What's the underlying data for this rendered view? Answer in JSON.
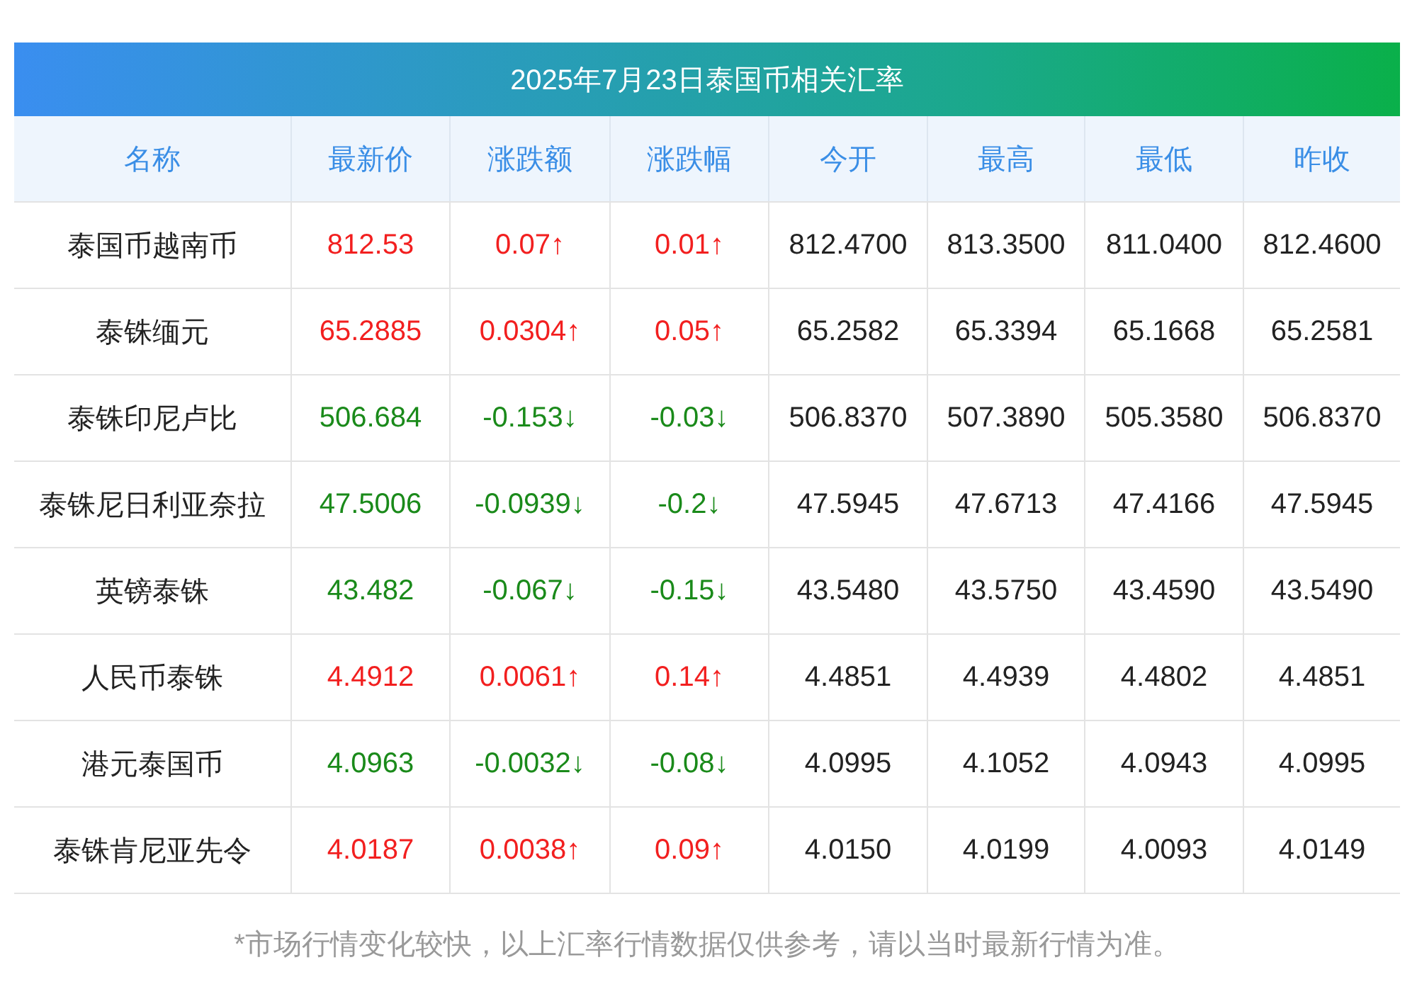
{
  "title": "2025年7月23日泰国币相关汇率",
  "columns": [
    "名称",
    "最新价",
    "涨跌额",
    "涨跌幅",
    "今开",
    "最高",
    "最低",
    "昨收"
  ],
  "rows": [
    {
      "rising": true,
      "cells": [
        "泰国币越南币",
        "812.53",
        "0.07↑",
        "0.01↑",
        "812.4700",
        "813.3500",
        "811.0400",
        "812.4600"
      ]
    },
    {
      "rising": true,
      "cells": [
        "泰铢缅元",
        "65.2885",
        "0.0304↑",
        "0.05↑",
        "65.2582",
        "65.3394",
        "65.1668",
        "65.2581"
      ]
    },
    {
      "rising": false,
      "cells": [
        "泰铢印尼卢比",
        "506.684",
        "-0.153↓",
        "-0.03↓",
        "506.8370",
        "507.3890",
        "505.3580",
        "506.8370"
      ]
    },
    {
      "rising": false,
      "cells": [
        "泰铢尼日利亚奈拉",
        "47.5006",
        "-0.0939↓",
        "-0.2↓",
        "47.5945",
        "47.6713",
        "47.4166",
        "47.5945"
      ]
    },
    {
      "rising": false,
      "cells": [
        "英镑泰铢",
        "43.482",
        "-0.067↓",
        "-0.15↓",
        "43.5480",
        "43.5750",
        "43.4590",
        "43.5490"
      ]
    },
    {
      "rising": true,
      "cells": [
        "人民币泰铢",
        "4.4912",
        "0.0061↑",
        "0.14↑",
        "4.4851",
        "4.4939",
        "4.4802",
        "4.4851"
      ]
    },
    {
      "rising": false,
      "cells": [
        "港元泰国币",
        "4.0963",
        "-0.0032↓",
        "-0.08↓",
        "4.0995",
        "4.1052",
        "4.0943",
        "4.0995"
      ]
    },
    {
      "rising": true,
      "cells": [
        "泰铢肯尼亚先令",
        "4.0187",
        "0.0038↑",
        "0.09↑",
        "4.0150",
        "4.0199",
        "4.0093",
        "4.0149"
      ]
    }
  ],
  "footnote": "*市场行情变化较快，以上汇率行情数据仅供参考，请以当时最新行情为准。"
}
